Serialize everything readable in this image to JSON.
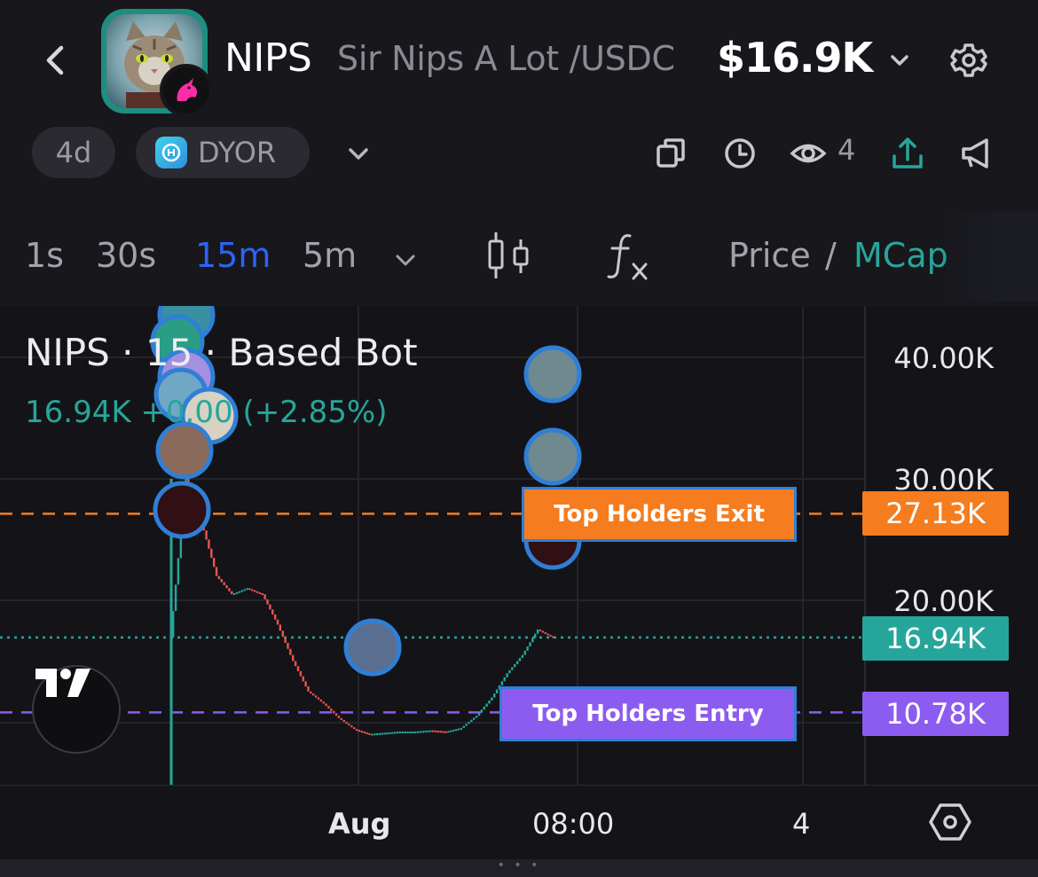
{
  "header": {
    "symbol": "NIPS",
    "pair_name": "Sir Nips A Lot /USDC",
    "market_cap": "$16.9K"
  },
  "subbar": {
    "age": "4d",
    "dyor_label": "DYOR",
    "watchers": "4"
  },
  "timeframes": {
    "items": [
      "1s",
      "30s",
      "15m",
      "5m"
    ],
    "active": "15m",
    "price_label": "Price",
    "separator": "/",
    "mcap_label": "MCap"
  },
  "chart": {
    "legend_title": "NIPS · 15 · Based Bot",
    "legend_values": "16.94K  +0.00 (+2.85%)",
    "y_ticks": [
      "40.00K",
      "30.00K",
      "20.00K"
    ],
    "price_tags": {
      "exit": "27.13K",
      "current": "16.94K",
      "entry": "10.78K"
    },
    "markers": {
      "exit_label": "Top Holders Exit",
      "entry_label": "Top Holders Entry"
    },
    "x_ticks": [
      "Aug",
      "08:00",
      "4"
    ],
    "colors": {
      "up": "#26a69a",
      "down": "#ef5350",
      "exit": "#f57c1f",
      "entry": "#8c5cf0",
      "accent": "#2e63f6"
    }
  },
  "chart_data": {
    "type": "line",
    "y_axis": "MCap",
    "ylim": [
      8000,
      42000
    ],
    "price_lines": [
      {
        "name": "Top Holders Exit",
        "value": 27130
      },
      {
        "name": "Current",
        "value": 16940
      },
      {
        "name": "Top Holders Entry",
        "value": 10780
      }
    ],
    "series": [
      {
        "values": [
          16940,
          30000,
          26500,
          22000,
          20500,
          21000,
          20500,
          18000,
          15000,
          12500,
          11500,
          10300,
          9400,
          9000,
          9100,
          9200,
          9200,
          9300,
          9200,
          9500,
          10500,
          12000,
          14000,
          15500,
          17600,
          16940
        ]
      }
    ]
  }
}
